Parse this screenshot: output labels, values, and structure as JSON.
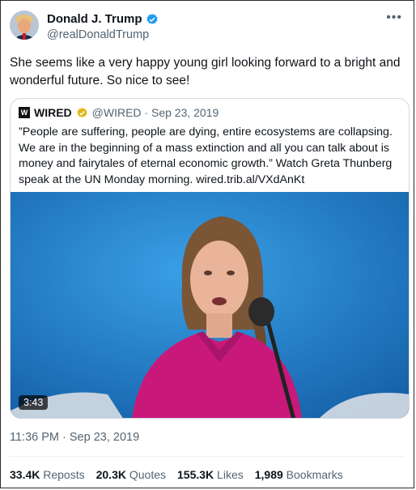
{
  "author": {
    "name": "Donald J. Trump",
    "handle": "@realDonaldTrump"
  },
  "more_icon": "•••",
  "tweet_text": "She seems like a very happy young girl looking forward to a bright and wonderful future. So nice to see!",
  "quoted": {
    "logo_text": "W",
    "name": "WIRED",
    "handle_date": "@WIRED · Sep 23, 2019",
    "text": "”People are suffering, people are dying, entire ecosystems are collapsing. We are in the beginning of a mass extinction and all you can talk about is money and fairytales of eternal economic growth.” Watch Greta Thunberg speak at the UN Monday morning. wired.trib.al/VXdAnKt",
    "video_duration": "3:43"
  },
  "timestamp": "11:36 PM · Sep 23, 2019",
  "stats": {
    "reposts_value": "33.4K",
    "reposts_label": "Reposts",
    "quotes_value": "20.3K",
    "quotes_label": "Quotes",
    "likes_value": "155.3K",
    "likes_label": "Likes",
    "bookmarks_value": "1,989",
    "bookmarks_label": "Bookmarks"
  },
  "colors": {
    "verified_blue": "#1d9bf0",
    "verified_gold": "#e2b719",
    "secondary_text": "#536471"
  }
}
